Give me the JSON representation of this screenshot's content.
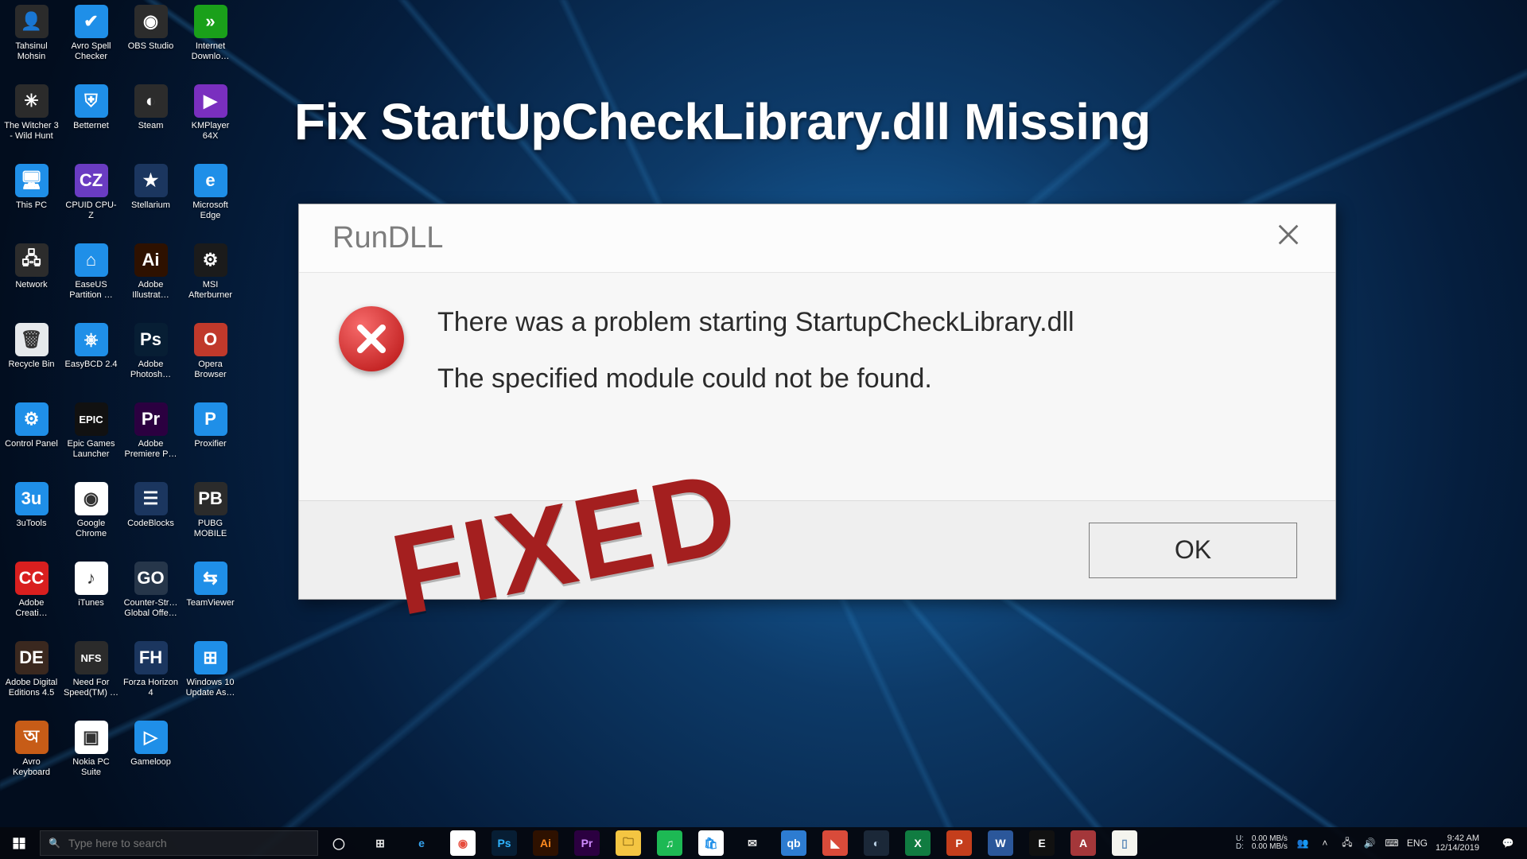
{
  "headline": "Fix StartUpCheckLibrary.dll Missing",
  "stamp": "FIXED",
  "dialog": {
    "title": "RunDLL",
    "line1": "There was a problem starting StartupCheckLibrary.dll",
    "line2": "The specified module could not be found.",
    "ok": "OK"
  },
  "desktop_icons": [
    {
      "label": "Tahsinul Mohsin",
      "bg": "#2b2b2b",
      "glyph": "👤"
    },
    {
      "label": "Avro Spell Checker",
      "bg": "#1f8fe8",
      "glyph": "✔"
    },
    {
      "label": "OBS Studio",
      "bg": "#2c2c2c",
      "glyph": "◉"
    },
    {
      "label": "Internet Downlo…",
      "bg": "#1aa01a",
      "glyph": "»"
    },
    {
      "label": "The Witcher 3 - Wild Hunt",
      "bg": "#2b2b2b",
      "glyph": "✳"
    },
    {
      "label": "Betternet",
      "bg": "#1f8fe8",
      "glyph": "⛨"
    },
    {
      "label": "Steam",
      "bg": "#2c2c2c",
      "glyph": "◐"
    },
    {
      "label": "KMPlayer 64X",
      "bg": "#7a2fbf",
      "glyph": "▶"
    },
    {
      "label": "This PC",
      "bg": "#1f8fe8",
      "glyph": "🖥"
    },
    {
      "label": "CPUID CPU-Z",
      "bg": "#6a3cc2",
      "glyph": "CZ"
    },
    {
      "label": "Stellarium",
      "bg": "#1b365f",
      "glyph": "★"
    },
    {
      "label": "Microsoft Edge",
      "bg": "#1f8fe8",
      "glyph": "e"
    },
    {
      "label": "Network",
      "bg": "#2c2c2c",
      "glyph": "🖧"
    },
    {
      "label": "EaseUS Partition …",
      "bg": "#1f8fe8",
      "glyph": "⌂"
    },
    {
      "label": "Adobe Illustrat…",
      "bg": "#2e1100",
      "glyph": "Ai"
    },
    {
      "label": "MSI Afterburner",
      "bg": "#1b1b1b",
      "glyph": "⚙"
    },
    {
      "label": "Recycle Bin",
      "bg": "#e6e9ec",
      "glyph": "🗑"
    },
    {
      "label": "EasyBCD 2.4",
      "bg": "#1f8fe8",
      "glyph": "⎈"
    },
    {
      "label": "Adobe Photosh…",
      "bg": "#071e34",
      "glyph": "Ps"
    },
    {
      "label": "Opera Browser",
      "bg": "#c0392b",
      "glyph": "O"
    },
    {
      "label": "Control Panel",
      "bg": "#1f8fe8",
      "glyph": "⚙"
    },
    {
      "label": "Epic Games Launcher",
      "bg": "#111",
      "glyph": "EPIC"
    },
    {
      "label": "Adobe Premiere P…",
      "bg": "#2b0040",
      "glyph": "Pr"
    },
    {
      "label": "Proxifier",
      "bg": "#1f8fe8",
      "glyph": "P"
    },
    {
      "label": "3uTools",
      "bg": "#1f8fe8",
      "glyph": "3u"
    },
    {
      "label": "Google Chrome",
      "bg": "#fff",
      "glyph": "◉"
    },
    {
      "label": "CodeBlocks",
      "bg": "#1b365f",
      "glyph": "☰"
    },
    {
      "label": "PUBG MOBILE",
      "bg": "#2b2b2b",
      "glyph": "PB"
    },
    {
      "label": "Adobe Creati…",
      "bg": "#d91f1f",
      "glyph": "CC"
    },
    {
      "label": "iTunes",
      "bg": "#fff",
      "glyph": "♪"
    },
    {
      "label": "Counter-Str… Global Offe…",
      "bg": "#26364a",
      "glyph": "GO"
    },
    {
      "label": "TeamViewer",
      "bg": "#1f8fe8",
      "glyph": "⇆"
    },
    {
      "label": "Adobe Digital Editions 4.5",
      "bg": "#3a281f",
      "glyph": "DE"
    },
    {
      "label": "Need For Speed(TM) …",
      "bg": "#2b2b2b",
      "glyph": "NFS"
    },
    {
      "label": "Forza Horizon 4",
      "bg": "#1b365f",
      "glyph": "FH"
    },
    {
      "label": "Windows 10 Update As…",
      "bg": "#1f8fe8",
      "glyph": "⊞"
    },
    {
      "label": "Avro Keyboard",
      "bg": "#c75c17",
      "glyph": "অ"
    },
    {
      "label": "Nokia PC Suite",
      "bg": "#ffffff",
      "glyph": "▣"
    },
    {
      "label": "Gameloop",
      "bg": "#1f8fe8",
      "glyph": "▷"
    }
  ],
  "taskbar": {
    "search_placeholder": "Type here to search",
    "pinned": [
      {
        "name": "cortana-icon",
        "bg": "transparent",
        "glyph": "◯",
        "fg": "#e6e6e6"
      },
      {
        "name": "task-view-icon",
        "bg": "transparent",
        "glyph": "⊞",
        "fg": "#e6e6e6"
      },
      {
        "name": "edge-icon",
        "bg": "transparent",
        "glyph": "e",
        "fg": "#35a3ef"
      },
      {
        "name": "chrome-icon",
        "bg": "#fff",
        "glyph": "◉",
        "fg": "#e74c3c"
      },
      {
        "name": "photoshop-icon",
        "bg": "#071e34",
        "glyph": "Ps",
        "fg": "#2fb4ff"
      },
      {
        "name": "illustrator-icon",
        "bg": "#2e1100",
        "glyph": "Ai",
        "fg": "#ff8a1f"
      },
      {
        "name": "premiere-icon",
        "bg": "#2b0040",
        "glyph": "Pr",
        "fg": "#cf8cff"
      },
      {
        "name": "file-explorer-icon",
        "bg": "#f4c542",
        "glyph": "🗀",
        "fg": "#815f0f"
      },
      {
        "name": "spotify-icon",
        "bg": "#1db954",
        "glyph": "♫",
        "fg": "#fff"
      },
      {
        "name": "store-icon",
        "bg": "#fff",
        "glyph": "🛍",
        "fg": "#1f8fe8"
      },
      {
        "name": "mail-icon",
        "bg": "transparent",
        "glyph": "✉",
        "fg": "#e6e6e6"
      },
      {
        "name": "qbittorrent-icon",
        "bg": "#2d7cd1",
        "glyph": "qb",
        "fg": "#fff"
      },
      {
        "name": "todoist-icon",
        "bg": "#d94b3a",
        "glyph": "◣",
        "fg": "#fff"
      },
      {
        "name": "steam-icon",
        "bg": "#1b2838",
        "glyph": "◐",
        "fg": "#bcd2e6"
      },
      {
        "name": "excel-icon",
        "bg": "#107c41",
        "glyph": "X",
        "fg": "#fff"
      },
      {
        "name": "powerpoint-icon",
        "bg": "#c43e1c",
        "glyph": "P",
        "fg": "#fff"
      },
      {
        "name": "word-icon",
        "bg": "#2b579a",
        "glyph": "W",
        "fg": "#fff"
      },
      {
        "name": "epic-icon",
        "bg": "#111",
        "glyph": "E",
        "fg": "#fff"
      },
      {
        "name": "access-icon",
        "bg": "#a4373a",
        "glyph": "A",
        "fg": "#fff"
      },
      {
        "name": "notepad-icon",
        "bg": "#f4f4ee",
        "glyph": "▯",
        "fg": "#5a89b8"
      }
    ],
    "net": {
      "u_label": "U:",
      "d_label": "D:",
      "u_val": "0.00 MB/s",
      "d_val": "0.00 MB/s"
    },
    "lang": "ENG",
    "time": "9:42 AM",
    "date": "12/14/2019"
  }
}
